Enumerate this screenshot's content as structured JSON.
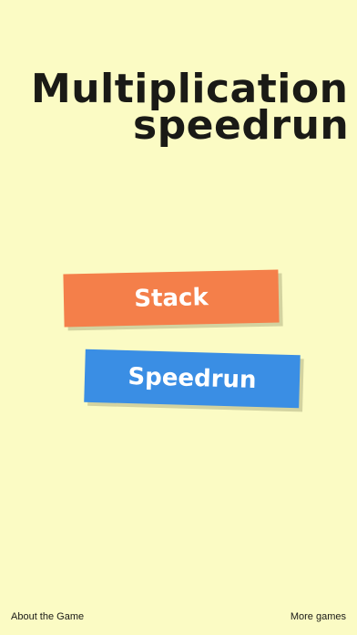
{
  "title": {
    "line1": "Multiplication",
    "line2": "speedrun"
  },
  "menu": {
    "stack_label": "Stack",
    "speedrun_label": "Speedrun"
  },
  "footer": {
    "about_label": "About the Game",
    "more_label": "More games"
  },
  "colors": {
    "background": "#fbfbc4",
    "title_text": "#1a1a16",
    "stack_button": "#f47f4a",
    "speedrun_button": "#3a8ee4",
    "button_shadow": "#d3d3a0",
    "button_text": "#ffffff"
  }
}
